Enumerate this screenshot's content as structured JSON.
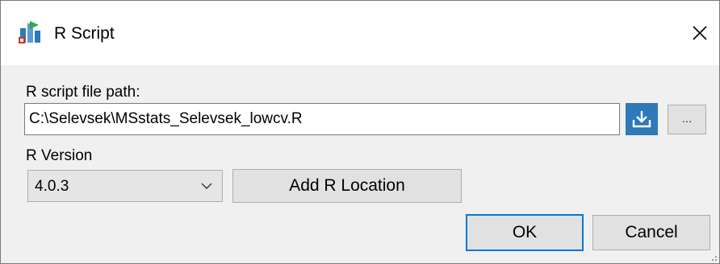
{
  "window": {
    "title": "R Script",
    "close_glyph": "✕",
    "icon": "r-script-app-icon"
  },
  "form": {
    "path_label": "R script file path:",
    "path_value": "C:\\Selevsek\\MSstats_Selevsek_lowcv.R",
    "browse_icon": "download-folder-icon",
    "ellipsis_label": "...",
    "version_label": "R Version",
    "version_selected": "4.0.3",
    "add_location_label": "Add R Location"
  },
  "buttons": {
    "ok_label": "OK",
    "cancel_label": "Cancel"
  },
  "colors": {
    "accent": "#2f79b9",
    "focus_border": "#0078d7",
    "dialog_bg": "#f0f0f0"
  }
}
